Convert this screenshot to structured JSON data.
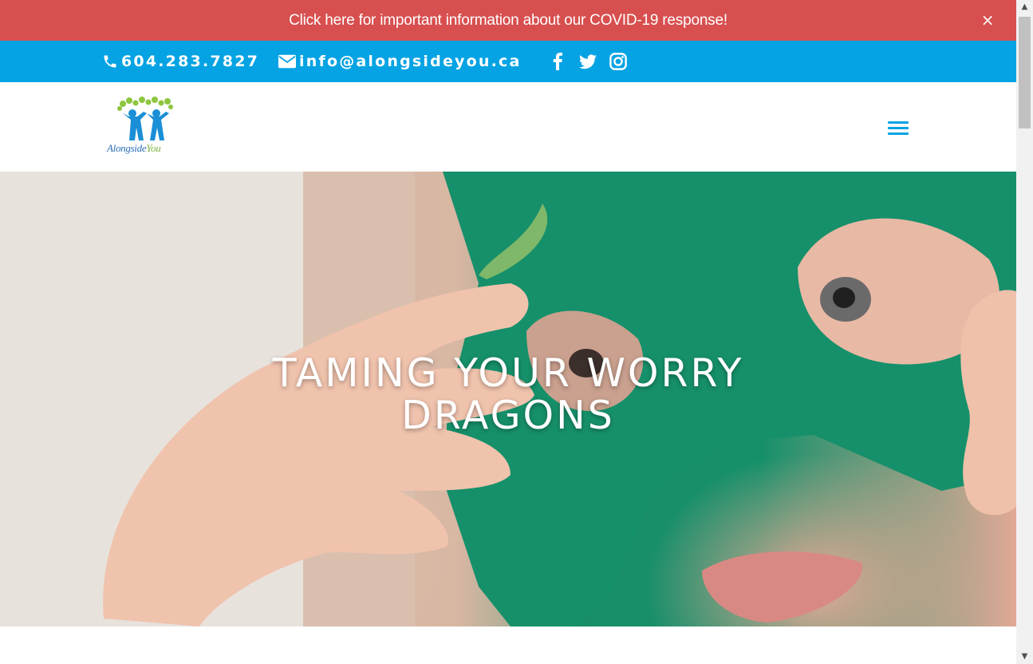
{
  "announcement": {
    "text": "Click here for important information about our COVID-19 response!",
    "close": "×"
  },
  "contact": {
    "phone": "604.283.7827",
    "email": "info@alongsideyou.ca",
    "social": [
      "facebook-icon",
      "twitter-icon",
      "instagram-icon"
    ]
  },
  "header": {
    "logo_text_main": "Alongside",
    "logo_text_accent": "You"
  },
  "hero": {
    "title_line1": "TAMING YOUR WORRY",
    "title_line2": "DRAGONS"
  },
  "colors": {
    "announcement_bg": "#d84f4f",
    "contact_bg": "#05a3e3",
    "accent": "#05a3e3",
    "mask_green": "#15906a"
  }
}
